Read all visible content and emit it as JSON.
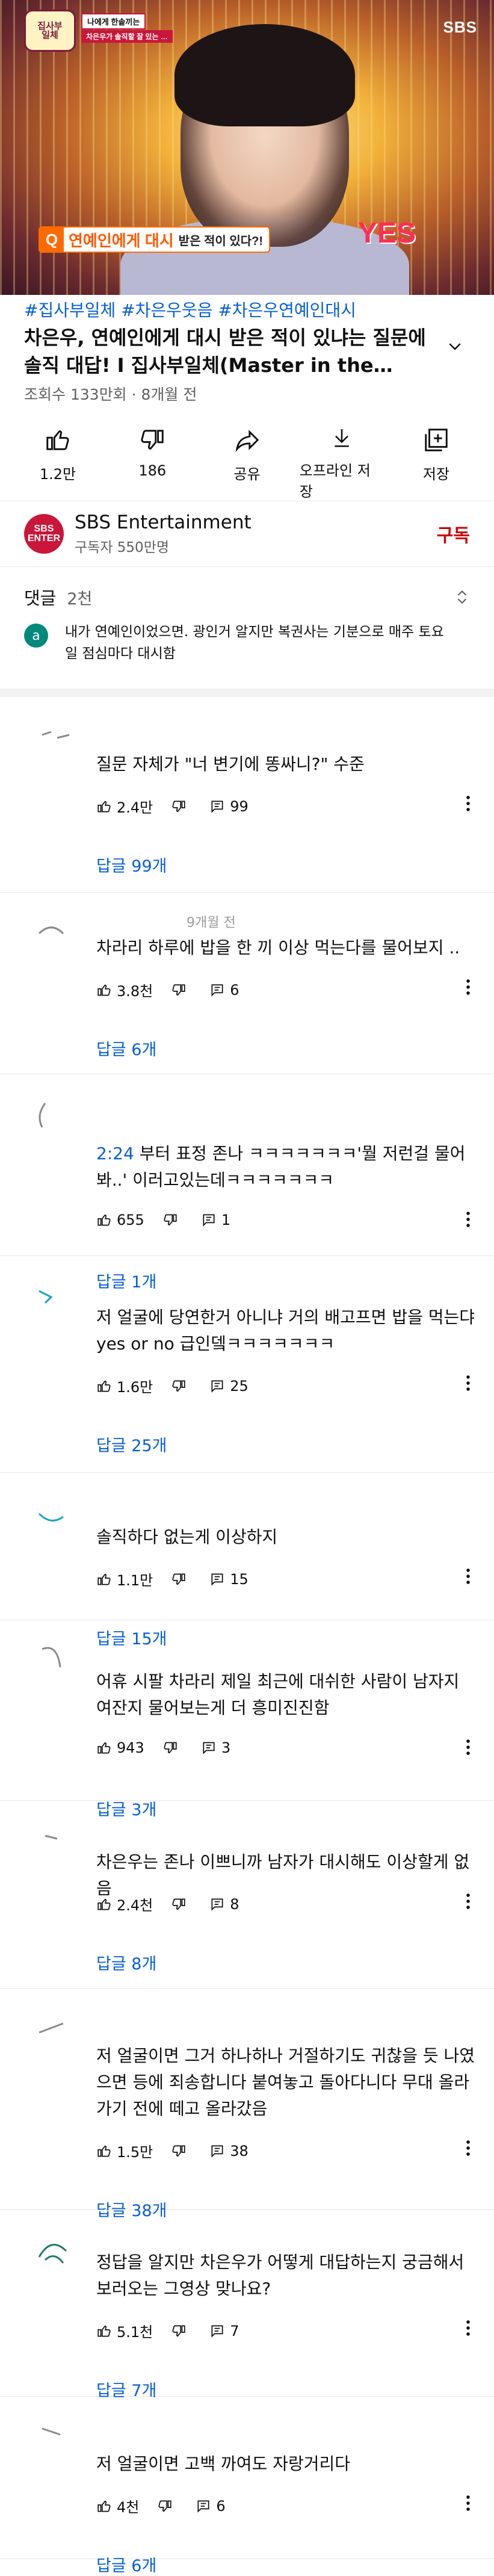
{
  "video": {
    "logo_text": "집사부\n일체",
    "tag_top": "나에게 한솥끼는",
    "tag_sub": "차은우가 솔직할 잘 있는 …",
    "network": "SBS",
    "caption_q": "Q",
    "caption_main": "연예인에게 대시",
    "caption_rest": "받은 적이 있다?!",
    "overlay_yes": "YES"
  },
  "meta": {
    "tags": "#집사부일체 #차은우웃음 #차은우연예인대시",
    "title": "차은우, 연예인에게 대시 받은 적이 있냐는 질문에 솔직 대답! I 집사부일체(Master in the…",
    "views": "조회수 133만회 · 8개월 전"
  },
  "actions": [
    {
      "icon": "thumb-up-icon",
      "label": "1.2만"
    },
    {
      "icon": "thumb-down-icon",
      "label": "186"
    },
    {
      "icon": "share-icon",
      "label": "공유"
    },
    {
      "icon": "download-icon",
      "label": "오프라인 저장"
    },
    {
      "icon": "save-playlist-icon",
      "label": "저장"
    }
  ],
  "channel": {
    "avatar_text": "SBS\nENTER",
    "name": "SBS Entertainment",
    "subscribers": "구독자 550만명",
    "subscribe_label": "구독"
  },
  "comments_header": {
    "title": "댓글",
    "count": "2천"
  },
  "pinned": {
    "avatar": "a",
    "text": "내가 연예인이었으면. 광인거 알지만 복권사는 기분으로 매주 토요일 점심마다 대시함"
  },
  "comments": [
    {
      "author": "",
      "text": "질문 자체가 \"너 변기에 똥싸니?\" 수준",
      "likes": "2.4만",
      "replies": "99",
      "reply_label": "답글 99개"
    },
    {
      "author": "9개월 전",
      "text": "차라리 하루에 밥을 한 끼 이상 먹는다를 물어보지 ..",
      "likes": "3.8천",
      "replies": "6",
      "reply_label": "답글 6개"
    },
    {
      "author": "",
      "timestamp": "2:24",
      "text": " 부터 표정 존나 ㅋㅋㅋㅋㅋㅋㅋ'뭘 저런걸 물어봐..' 이러고있는데ㅋㅋㅋㅋㅋㅋㅋ",
      "likes": "655",
      "replies": "1",
      "reply_label": "답글 1개"
    },
    {
      "author": "",
      "text": "저 얼굴에 당연한거 아니냐 거의 배고프면 밥을 먹는댜 yes or no 급인뎈ㅋㅋㅋㅋㅋㅋㅋ",
      "likes": "1.6만",
      "replies": "25",
      "reply_label": "답글 25개"
    },
    {
      "author": "",
      "text": "솔직하다 없는게 이상하지",
      "likes": "1.1만",
      "replies": "15",
      "reply_label": "답글 15개"
    },
    {
      "author": "",
      "text": "어휴 시팔 차라리 제일 최근에 대쉬한 사람이 남자지 여잔지 물어보는게 더 흥미진진함",
      "likes": "943",
      "replies": "3",
      "reply_label": "답글 3개"
    },
    {
      "author": "",
      "text": "차은우는 존나 이쁘니까 남자가 대시해도 이상할게 없음",
      "likes": "2.4천",
      "replies": "8",
      "reply_label": "답글 8개"
    },
    {
      "author": "",
      "text": "저 얼굴이면 그거 하나하나 거절하기도 귀찮을 듯 나였으면 등에 죄송합니다 붙여놓고 돌아다니다 무대 올라가기 전에 떼고 올라갔음",
      "likes": "1.5만",
      "replies": "38",
      "reply_label": "답글 38개"
    },
    {
      "author": "",
      "text": "정답을 알지만 차은우가 어떻게 대답하는지 궁금해서 보러오는 그영상 맞나요?",
      "likes": "5.1천",
      "replies": "7",
      "reply_label": "답글 7개"
    },
    {
      "author": "",
      "text": "저 얼굴이면 고백 까여도 자랑거리다",
      "likes": "4천",
      "replies": "6",
      "reply_label": "답글 6개"
    }
  ]
}
